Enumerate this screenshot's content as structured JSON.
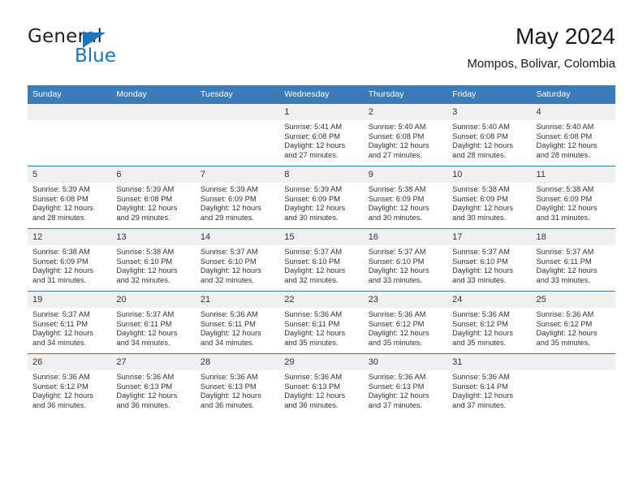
{
  "brand": {
    "name_part1": "General",
    "name_part2": "Blue",
    "triangle_icon": "triangle-logo-icon",
    "accent_color": "#1b76bc"
  },
  "header": {
    "title": "May 2024",
    "subtitle": "Mompos, Bolivar, Colombia"
  },
  "calendar": {
    "header_bg": "#3a7cb9",
    "daynum_bg": "#f0f0f0",
    "weekdays": [
      "Sunday",
      "Monday",
      "Tuesday",
      "Wednesday",
      "Thursday",
      "Friday",
      "Saturday"
    ],
    "weeks": [
      [
        {
          "day": "",
          "lines": []
        },
        {
          "day": "",
          "lines": []
        },
        {
          "day": "",
          "lines": []
        },
        {
          "day": "1",
          "lines": [
            "Sunrise: 5:41 AM",
            "Sunset: 6:08 PM",
            "Daylight: 12 hours",
            "and 27 minutes."
          ]
        },
        {
          "day": "2",
          "lines": [
            "Sunrise: 5:40 AM",
            "Sunset: 6:08 PM",
            "Daylight: 12 hours",
            "and 27 minutes."
          ]
        },
        {
          "day": "3",
          "lines": [
            "Sunrise: 5:40 AM",
            "Sunset: 6:08 PM",
            "Daylight: 12 hours",
            "and 28 minutes."
          ]
        },
        {
          "day": "4",
          "lines": [
            "Sunrise: 5:40 AM",
            "Sunset: 6:08 PM",
            "Daylight: 12 hours",
            "and 28 minutes."
          ]
        }
      ],
      [
        {
          "day": "5",
          "lines": [
            "Sunrise: 5:39 AM",
            "Sunset: 6:08 PM",
            "Daylight: 12 hours",
            "and 28 minutes."
          ]
        },
        {
          "day": "6",
          "lines": [
            "Sunrise: 5:39 AM",
            "Sunset: 6:08 PM",
            "Daylight: 12 hours",
            "and 29 minutes."
          ]
        },
        {
          "day": "7",
          "lines": [
            "Sunrise: 5:39 AM",
            "Sunset: 6:09 PM",
            "Daylight: 12 hours",
            "and 29 minutes."
          ]
        },
        {
          "day": "8",
          "lines": [
            "Sunrise: 5:39 AM",
            "Sunset: 6:09 PM",
            "Daylight: 12 hours",
            "and 30 minutes."
          ]
        },
        {
          "day": "9",
          "lines": [
            "Sunrise: 5:38 AM",
            "Sunset: 6:09 PM",
            "Daylight: 12 hours",
            "and 30 minutes."
          ]
        },
        {
          "day": "10",
          "lines": [
            "Sunrise: 5:38 AM",
            "Sunset: 6:09 PM",
            "Daylight: 12 hours",
            "and 30 minutes."
          ]
        },
        {
          "day": "11",
          "lines": [
            "Sunrise: 5:38 AM",
            "Sunset: 6:09 PM",
            "Daylight: 12 hours",
            "and 31 minutes."
          ]
        }
      ],
      [
        {
          "day": "12",
          "lines": [
            "Sunrise: 5:38 AM",
            "Sunset: 6:09 PM",
            "Daylight: 12 hours",
            "and 31 minutes."
          ]
        },
        {
          "day": "13",
          "lines": [
            "Sunrise: 5:38 AM",
            "Sunset: 6:10 PM",
            "Daylight: 12 hours",
            "and 32 minutes."
          ]
        },
        {
          "day": "14",
          "lines": [
            "Sunrise: 5:37 AM",
            "Sunset: 6:10 PM",
            "Daylight: 12 hours",
            "and 32 minutes."
          ]
        },
        {
          "day": "15",
          "lines": [
            "Sunrise: 5:37 AM",
            "Sunset: 6:10 PM",
            "Daylight: 12 hours",
            "and 32 minutes."
          ]
        },
        {
          "day": "16",
          "lines": [
            "Sunrise: 5:37 AM",
            "Sunset: 6:10 PM",
            "Daylight: 12 hours",
            "and 33 minutes."
          ]
        },
        {
          "day": "17",
          "lines": [
            "Sunrise: 5:37 AM",
            "Sunset: 6:10 PM",
            "Daylight: 12 hours",
            "and 33 minutes."
          ]
        },
        {
          "day": "18",
          "lines": [
            "Sunrise: 5:37 AM",
            "Sunset: 6:11 PM",
            "Daylight: 12 hours",
            "and 33 minutes."
          ]
        }
      ],
      [
        {
          "day": "19",
          "lines": [
            "Sunrise: 5:37 AM",
            "Sunset: 6:11 PM",
            "Daylight: 12 hours",
            "and 34 minutes."
          ]
        },
        {
          "day": "20",
          "lines": [
            "Sunrise: 5:37 AM",
            "Sunset: 6:11 PM",
            "Daylight: 12 hours",
            "and 34 minutes."
          ]
        },
        {
          "day": "21",
          "lines": [
            "Sunrise: 5:36 AM",
            "Sunset: 6:11 PM",
            "Daylight: 12 hours",
            "and 34 minutes."
          ]
        },
        {
          "day": "22",
          "lines": [
            "Sunrise: 5:36 AM",
            "Sunset: 6:11 PM",
            "Daylight: 12 hours",
            "and 35 minutes."
          ]
        },
        {
          "day": "23",
          "lines": [
            "Sunrise: 5:36 AM",
            "Sunset: 6:12 PM",
            "Daylight: 12 hours",
            "and 35 minutes."
          ]
        },
        {
          "day": "24",
          "lines": [
            "Sunrise: 5:36 AM",
            "Sunset: 6:12 PM",
            "Daylight: 12 hours",
            "and 35 minutes."
          ]
        },
        {
          "day": "25",
          "lines": [
            "Sunrise: 5:36 AM",
            "Sunset: 6:12 PM",
            "Daylight: 12 hours",
            "and 35 minutes."
          ]
        }
      ],
      [
        {
          "day": "26",
          "lines": [
            "Sunrise: 5:36 AM",
            "Sunset: 6:12 PM",
            "Daylight: 12 hours",
            "and 36 minutes."
          ]
        },
        {
          "day": "27",
          "lines": [
            "Sunrise: 5:36 AM",
            "Sunset: 6:13 PM",
            "Daylight: 12 hours",
            "and 36 minutes."
          ]
        },
        {
          "day": "28",
          "lines": [
            "Sunrise: 5:36 AM",
            "Sunset: 6:13 PM",
            "Daylight: 12 hours",
            "and 36 minutes."
          ]
        },
        {
          "day": "29",
          "lines": [
            "Sunrise: 5:36 AM",
            "Sunset: 6:13 PM",
            "Daylight: 12 hours",
            "and 36 minutes."
          ]
        },
        {
          "day": "30",
          "lines": [
            "Sunrise: 5:36 AM",
            "Sunset: 6:13 PM",
            "Daylight: 12 hours",
            "and 37 minutes."
          ]
        },
        {
          "day": "31",
          "lines": [
            "Sunrise: 5:36 AM",
            "Sunset: 6:14 PM",
            "Daylight: 12 hours",
            "and 37 minutes."
          ]
        },
        {
          "day": "",
          "lines": []
        }
      ]
    ]
  }
}
